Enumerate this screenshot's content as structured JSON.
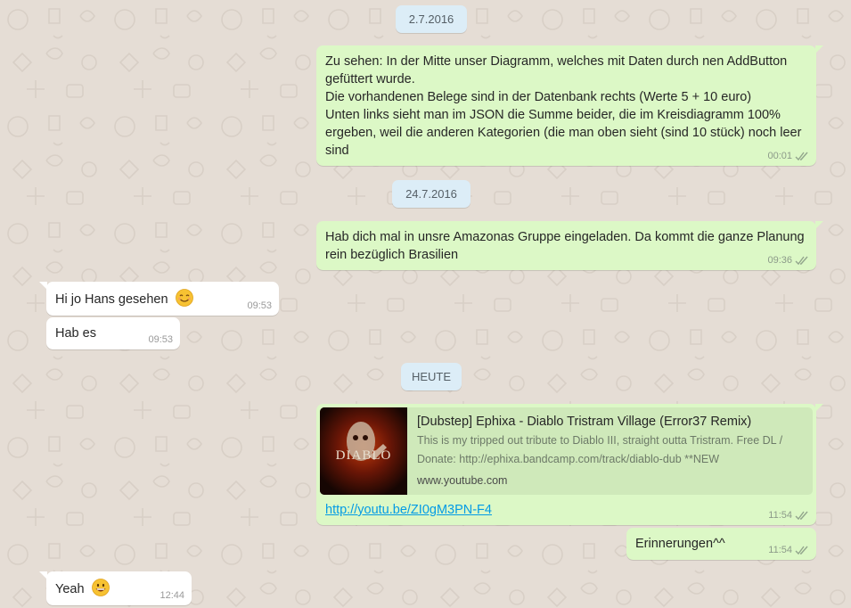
{
  "chat": {
    "dates": {
      "d1": "2.7.2016",
      "d2": "24.7.2016",
      "d3": "HEUTE"
    },
    "messages": {
      "m1": {
        "text": "Zu sehen: In der Mitte unser Diagramm, welches mit Daten durch nen AddButton gefüttert wurde.\nDie vorhandenen Belege sind in der Datenbank rechts (Werte 5 + 10 euro)\nUnten links sieht man im JSON die Summe beider, die im Kreisdiagramm 100% ergeben, weil die anderen Kategorien (die man oben sieht (sind 10 stück) noch leer sind",
        "time": "00:01"
      },
      "m2": {
        "text": "Hab dich mal in unsre Amazonas Gruppe eingeladen. Da kommt die ganze Planung rein bezüglich Brasilien",
        "time": "09:36"
      },
      "m3": {
        "text": "Hi jo Hans gesehen",
        "time": "09:53"
      },
      "m4": {
        "text": "Hab es",
        "time": "09:53"
      },
      "m5": {
        "preview_title": "[Dubstep] Ephixa - Diablo Tristram Village (Error37 Remix)",
        "preview_desc": "This is my tripped out tribute to Diablo III, straight outta Tristram. Free DL / Donate: http://ephixa.bandcamp.com/track/diablo-dub **NEW",
        "preview_host": "www.youtube.com",
        "thumb_text": "DIABLO",
        "link": "http://youtu.be/ZI0gM3PN-F4",
        "time": "11:54"
      },
      "m6": {
        "text": "Erinnerungen^^",
        "time": "11:54"
      },
      "m7": {
        "text": "Yeah",
        "time": "12:44"
      }
    }
  },
  "colors": {
    "background": "#e5ddd5",
    "outgoing_bubble": "#dcf8c6",
    "incoming_bubble": "#ffffff",
    "date_chip": "#dcedf7",
    "link": "#039be5"
  },
  "icons": [
    "double-check-icon",
    "smiling-face-emoji",
    "grinning-face-emoji",
    "diablo-thumbnail"
  ]
}
